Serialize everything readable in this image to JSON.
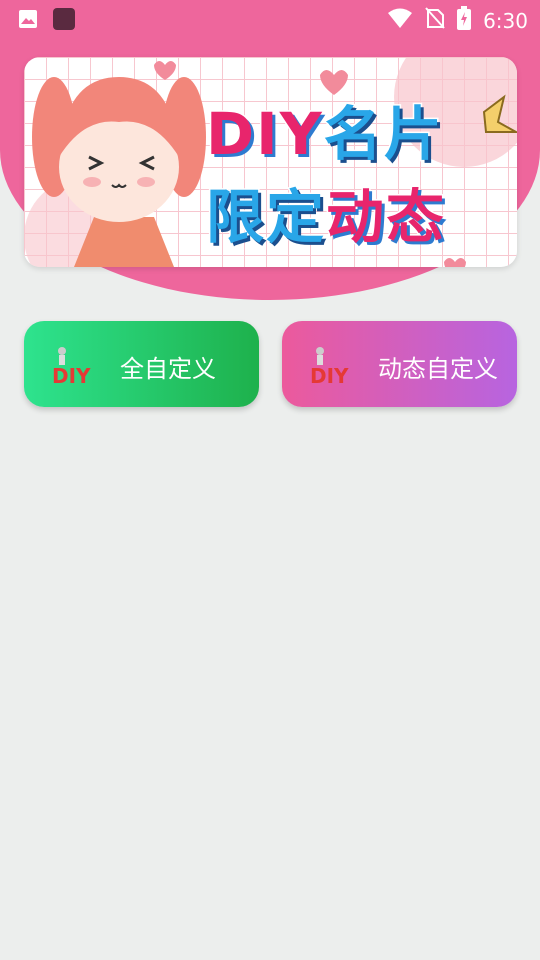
{
  "status_bar": {
    "time": "6:30",
    "left_icons": [
      "image-icon",
      "app-icon"
    ],
    "right_icons": [
      "wifi-icon",
      "no-sim-icon",
      "battery-charging-icon"
    ]
  },
  "banner": {
    "line1_a": "DIY",
    "line1_b": "名片",
    "line2_a": "限定",
    "line2_b": "动态"
  },
  "buttons": {
    "full_custom": {
      "label": "全自定义",
      "logo": "DIY"
    },
    "dynamic_custom": {
      "label": "动态自定义",
      "logo": "DIY"
    }
  },
  "colors": {
    "header": "#ee669c",
    "background": "#eceeed",
    "btn_full_start": "#2ee38e",
    "btn_full_end": "#1eb14c",
    "btn_dyn_start": "#ec5a9c",
    "btn_dyn_end": "#b764e0"
  }
}
